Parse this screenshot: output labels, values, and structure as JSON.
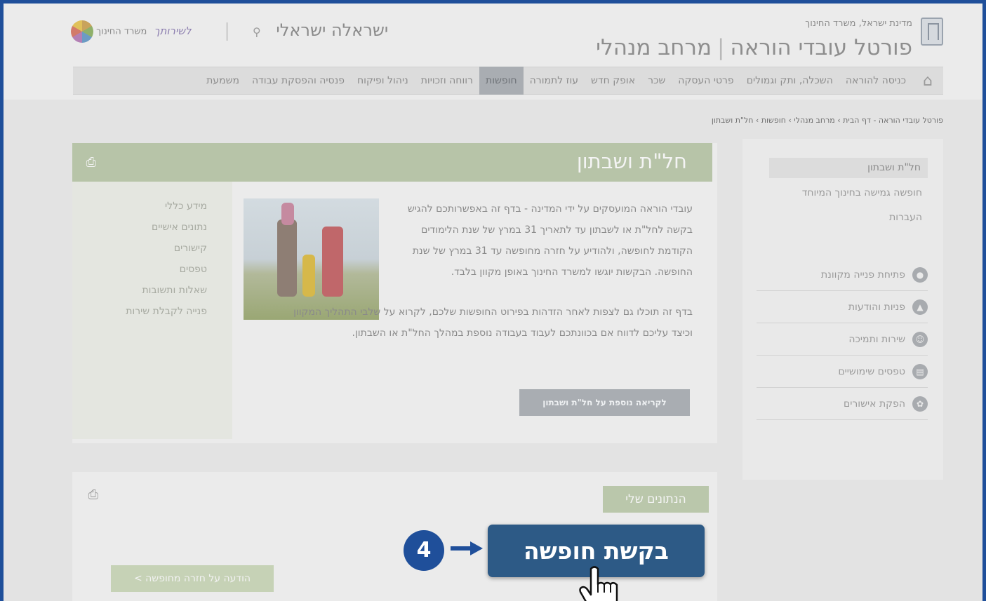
{
  "header": {
    "state_text": "מדינת ישראל, משרד החינוך",
    "portal_title": "פורטל עובדי הוראה",
    "portal_subtitle": "מרחב מנהלי",
    "title_separator": "|",
    "user_name": "ישראלה ישראלי",
    "moe_label": "משרד החינוך",
    "moe_script": "לשירותך"
  },
  "nav": {
    "items": [
      {
        "label": "כניסה להוראה"
      },
      {
        "label": "השכלה, ותק וגמולים"
      },
      {
        "label": "פרטי העסקה"
      },
      {
        "label": "שכר"
      },
      {
        "label": "אופק חדש"
      },
      {
        "label": "עוז לתמורה"
      },
      {
        "label": "חופשות"
      },
      {
        "label": "רווחה וזכויות"
      },
      {
        "label": "ניהול ופיקוח"
      },
      {
        "label": "פנסיה והפסקת עבודה"
      },
      {
        "label": "משמעת"
      }
    ],
    "active": "חופשות"
  },
  "breadcrumb": "פורטל עובדי הוראה - דף הבית › מרחב מנהלי › חופשות › חל\"ת ושבתון",
  "sidebar": {
    "links": [
      "חל\"ת ושבתון",
      "חופשה גמישה בחינוך המיוחד",
      "העברות"
    ],
    "actions": [
      {
        "label": "פתיחת פנייה מקוונת",
        "icon": "chat-icon"
      },
      {
        "label": "פניות והודעות",
        "icon": "inbox-icon"
      },
      {
        "label": "שירות ותמיכה",
        "icon": "support-icon"
      },
      {
        "label": "טפסים שימושיים",
        "icon": "form-icon"
      },
      {
        "label": "הפקת אישורים",
        "icon": "certificate-icon"
      }
    ]
  },
  "main": {
    "title": "חל\"ת ושבתון",
    "side_menu": [
      "מידע כללי",
      "נתונים אישיים",
      "קישורים",
      "טפסים",
      "שאלות ותשובות",
      "פנייה לקבלת שירות"
    ],
    "paragraph1": "עובדי הוראה המועסקים על ידי המדינה - בדף זה באפשרותכם להגיש בקשה לחל\"ת או לשבתון עד לתאריך 31 במרץ של שנת הלימודים הקודמת לחופשה, ולהודיע על חזרה מחופשה עד 31 במרץ של שנת החופשה. הבקשות יוגשו למשרד החינוך באופן מקוון בלבד.",
    "paragraph2": "בדף זה תוכלו גם לצפות לאחר הזדהות בפירוט החופשות שלכם, לקרוא על שלבי התהליך המקוון וכיצד עליכם לדווח אם בכוונתכם לעבוד בעבודה נוספת במהלך החל\"ת או השבתון.",
    "more_button": "לקריאה נוספת על חל\"ת ושבתון"
  },
  "data_section": {
    "title": "הנתונים שלי",
    "return_button": "הודעה על חזרה מחופשה >"
  },
  "callout": {
    "request_button": "בקשת חופשה",
    "step_number": "4"
  },
  "colors": {
    "frame_border": "#1f4f9a",
    "callout_button": "#2d5a86",
    "green_header": "#b7c4a8"
  }
}
